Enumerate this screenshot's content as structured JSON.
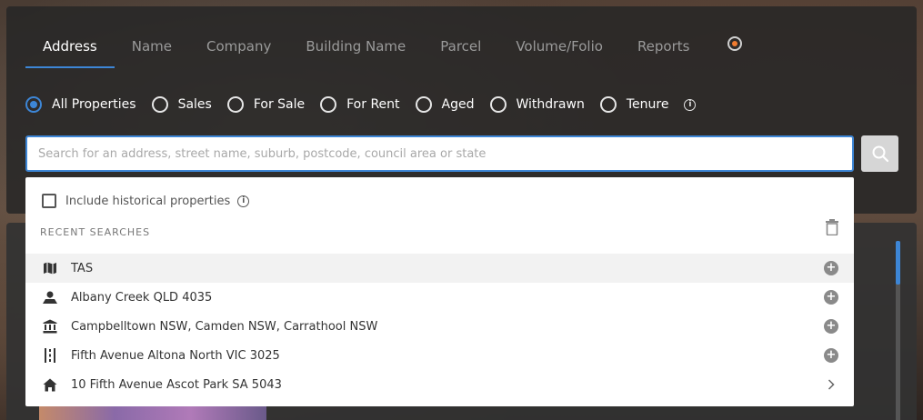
{
  "tabs": [
    {
      "label": "Address",
      "active": true
    },
    {
      "label": "Name"
    },
    {
      "label": "Company"
    },
    {
      "label": "Building Name"
    },
    {
      "label": "Parcel"
    },
    {
      "label": "Volume/Folio"
    },
    {
      "label": "Reports"
    }
  ],
  "filters": [
    {
      "label": "All Properties",
      "selected": true
    },
    {
      "label": "Sales"
    },
    {
      "label": "For Sale"
    },
    {
      "label": "For Rent"
    },
    {
      "label": "Aged"
    },
    {
      "label": "Withdrawn"
    },
    {
      "label": "Tenure"
    }
  ],
  "search": {
    "placeholder": "Search for an address, street name, suburb, postcode, council area or state",
    "value": ""
  },
  "dropdown": {
    "include_historical_label": "Include historical properties",
    "recent_title": "RECENT SEARCHES",
    "items": [
      {
        "icon": "map-icon",
        "label": "TAS",
        "action": "add"
      },
      {
        "icon": "suburb-icon",
        "label": "Albany Creek QLD 4035",
        "action": "add"
      },
      {
        "icon": "council-icon",
        "label": "Campbelltown NSW, Camden NSW, Carrathool NSW",
        "action": "add"
      },
      {
        "icon": "street-icon",
        "label": "Fifth Avenue Altona North VIC 3025",
        "action": "add"
      },
      {
        "icon": "home-icon",
        "label": "10 Fifth Avenue Ascot Park SA 5043",
        "action": "navigate"
      }
    ]
  },
  "colors": {
    "accent": "#3d86d6",
    "notification": "#f07b2f"
  }
}
